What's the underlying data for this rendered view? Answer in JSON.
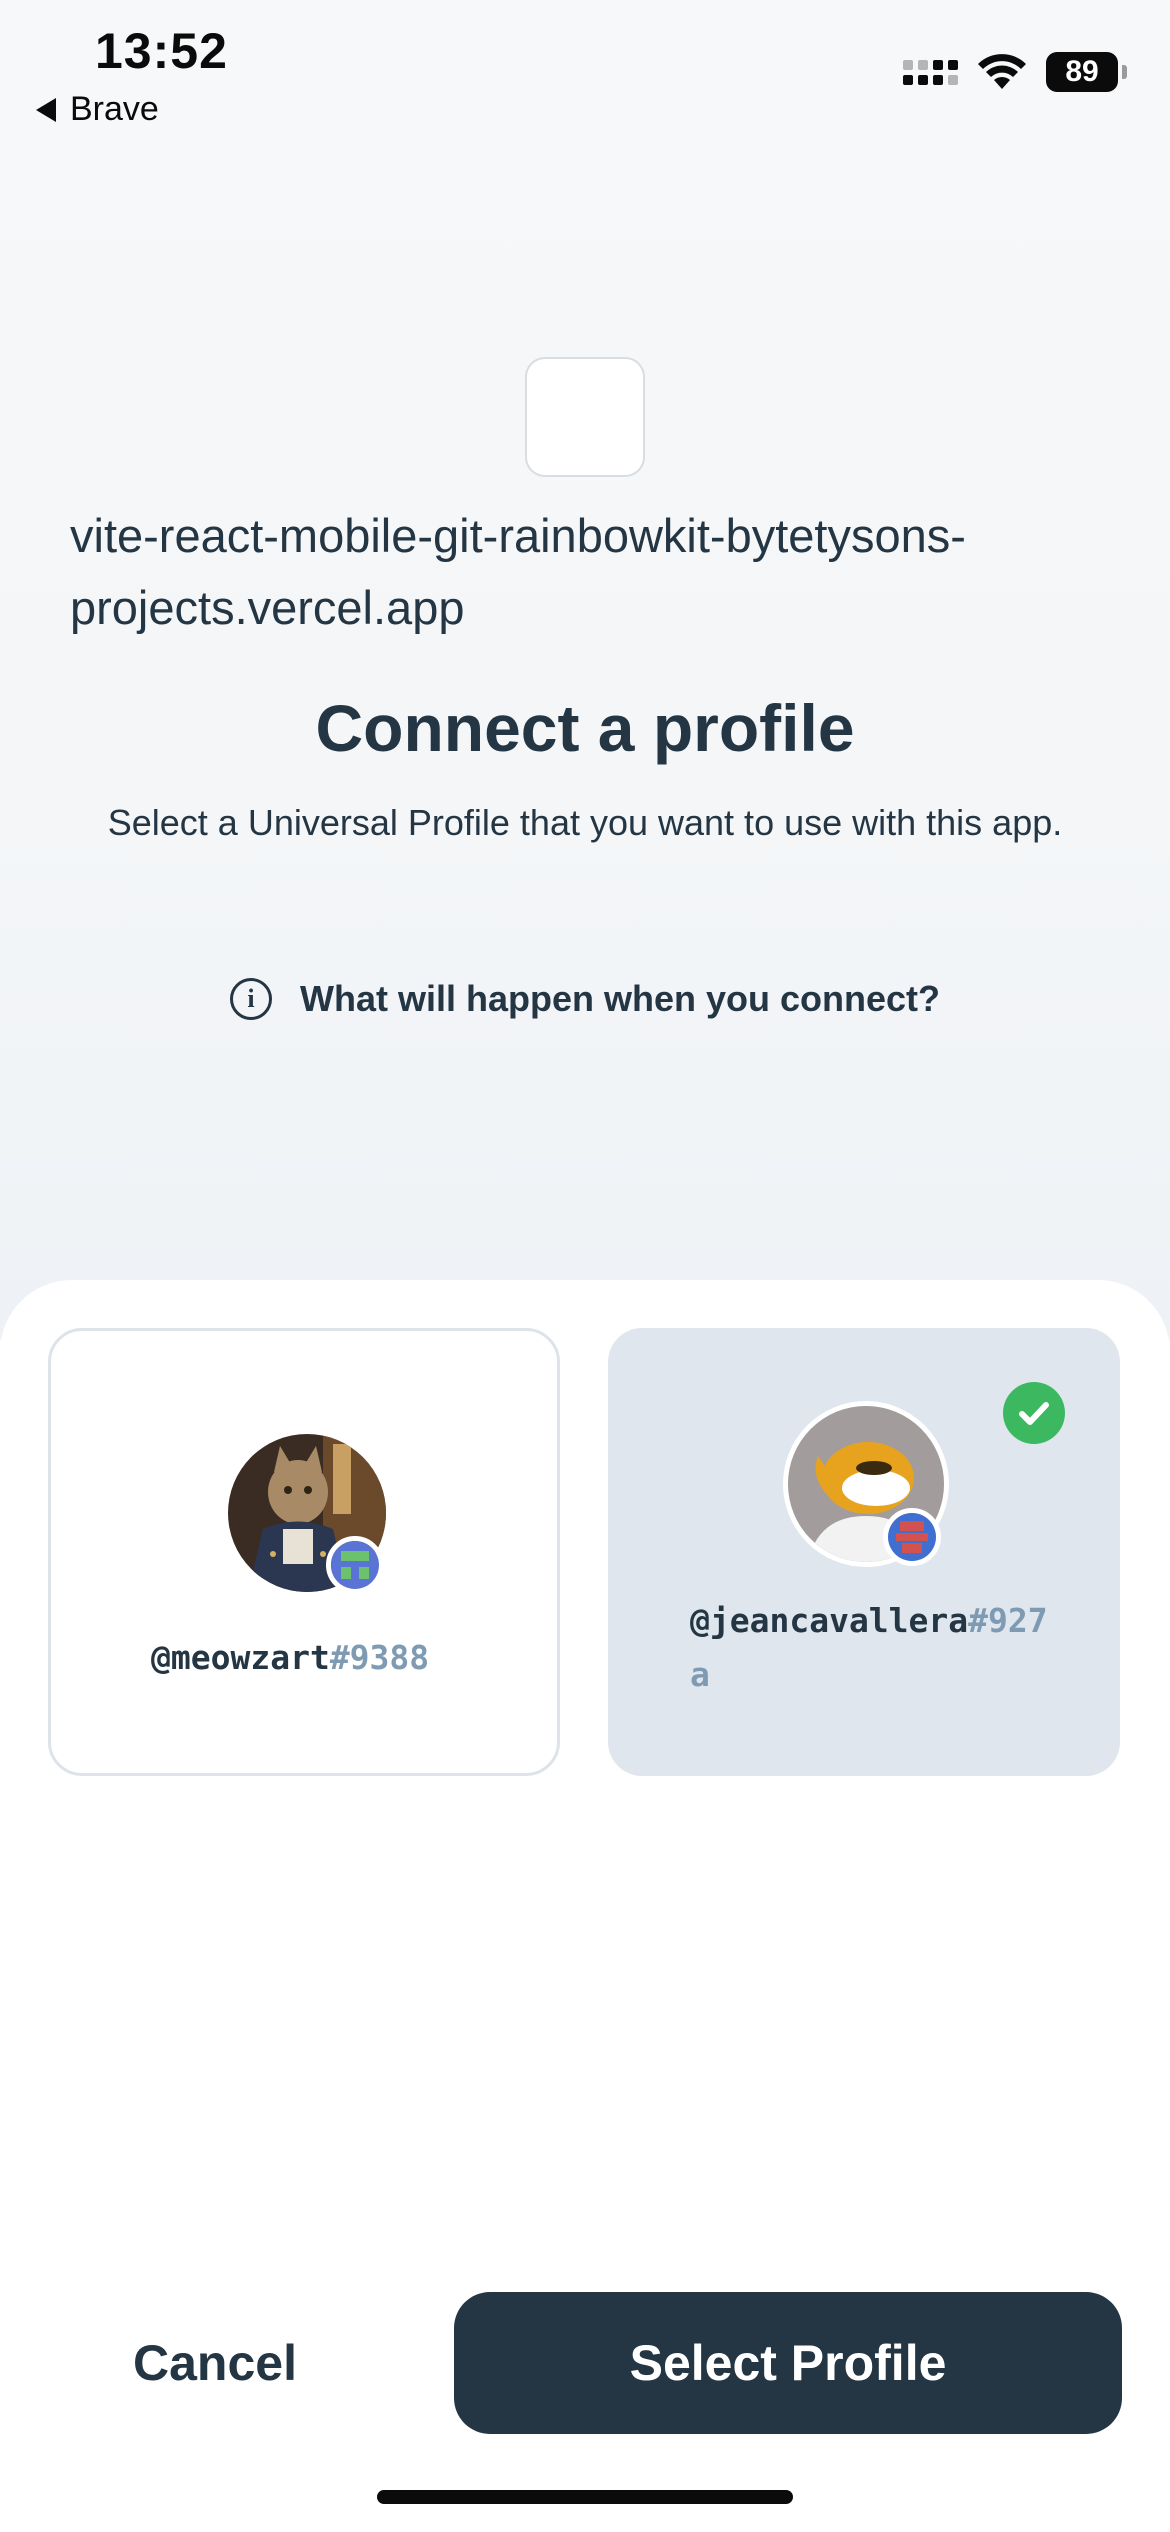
{
  "status_bar": {
    "time": "13:52",
    "back_label": "Brave",
    "battery": "89"
  },
  "app": {
    "url": "vite-react-mobile-git-rainbowkit-bytetysons-projects.vercel.app"
  },
  "dialog": {
    "title": "Connect a profile",
    "subtitle": "Select a Universal Profile that you want to use with this app.",
    "info_link": "What will happen when you connect?"
  },
  "profiles": [
    {
      "name": "@meowzart",
      "hash": "#9388",
      "selected": false,
      "avatar_icon": "cat-portrait-avatar"
    },
    {
      "name": "@jeancavallera",
      "hash": "#927a",
      "selected": true,
      "avatar_icon": "orca-avatar"
    }
  ],
  "actions": {
    "cancel": "Cancel",
    "select": "Select Profile"
  },
  "colors": {
    "primary": "#243543",
    "selected_card": "#dfe6ee",
    "check": "#3cb860",
    "hash": "#7f9bb3"
  }
}
